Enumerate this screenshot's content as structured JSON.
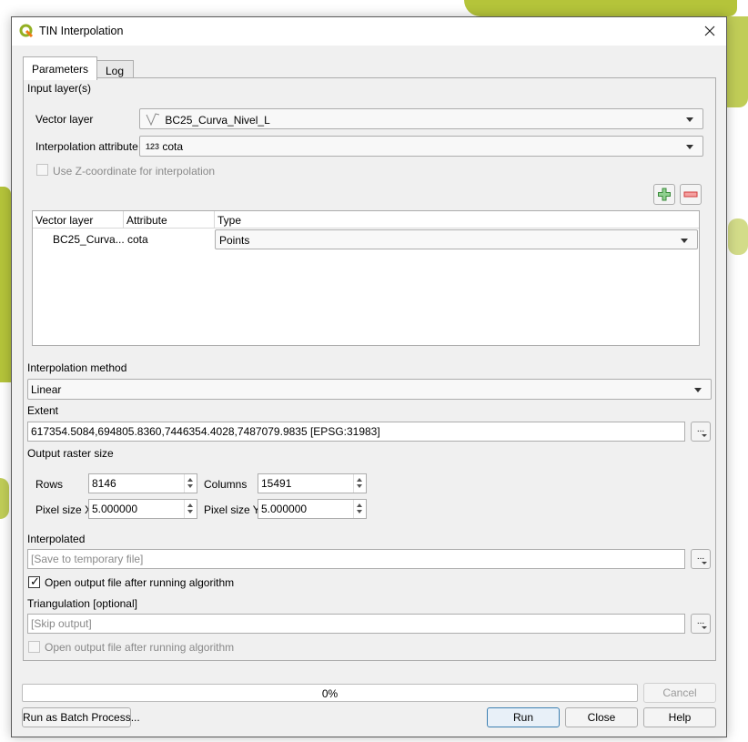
{
  "window": {
    "title": "TIN Interpolation",
    "app_icon": "qgis-logo-icon",
    "close_icon": "close-icon"
  },
  "tabs": [
    {
      "label": "Parameters",
      "active": true
    },
    {
      "label": "Log",
      "active": false
    }
  ],
  "input_layers": {
    "section_label": "Input layer(s)",
    "vector_layer_label": "Vector layer",
    "vector_layer_value": "BC25_Curva_Nivel_L",
    "vector_layer_icon": "line-layer-icon",
    "interpolation_attribute_label": "Interpolation attribute",
    "interpolation_attribute_value": "cota",
    "interpolation_attribute_icon_text": "123",
    "use_z_label": "Use Z-coordinate for interpolation",
    "use_z_checked": false,
    "use_z_enabled": false,
    "add_button_icon": "plus-icon",
    "remove_button_icon": "minus-icon",
    "table": {
      "headers": [
        "Vector layer",
        "Attribute",
        "Type"
      ],
      "rows": [
        {
          "vector_layer": "BC25_Curva...",
          "attribute": "cota",
          "type": "Points"
        }
      ]
    }
  },
  "interpolation_method": {
    "label": "Interpolation method",
    "value": "Linear"
  },
  "extent": {
    "label": "Extent",
    "value": "617354.5084,694805.8360,7446354.4028,7487079.9835 [EPSG:31983]",
    "button": "..."
  },
  "output_raster_size": {
    "label": "Output raster size",
    "rows_label": "Rows",
    "rows_value": "8146",
    "columns_label": "Columns",
    "columns_value": "15491",
    "pixel_x_label": "Pixel size X",
    "pixel_x_value": "5.000000",
    "pixel_y_label": "Pixel size Y",
    "pixel_y_value": "5.000000"
  },
  "interpolated": {
    "label": "Interpolated",
    "placeholder": "[Save to temporary file]",
    "button": "...",
    "open_output_label": "Open output file after running algorithm",
    "open_output_checked": true
  },
  "triangulation": {
    "label": "Triangulation [optional]",
    "placeholder": "[Skip output]",
    "button": "...",
    "open_output_label": "Open output file after running algorithm",
    "open_output_checked": false,
    "open_output_enabled": false
  },
  "footer": {
    "progress_text": "0%",
    "progress_value": 0,
    "cancel_label": "Cancel",
    "batch_label": "Run as Batch Process...",
    "run_label": "Run",
    "close_label": "Close",
    "help_label": "Help"
  }
}
